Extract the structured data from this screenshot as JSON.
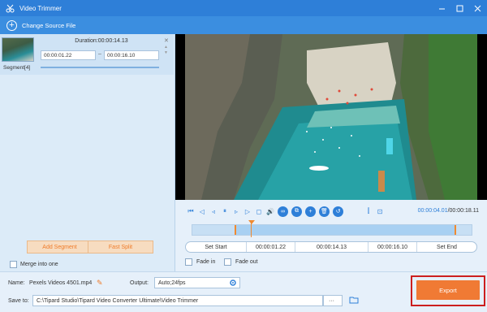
{
  "window": {
    "title": "Video Trimmer"
  },
  "source": {
    "change_label": "Change Source File"
  },
  "segment": {
    "label": "Segment[4]",
    "duration_label": "Duration:00:00:14.13",
    "start": "00:00:01.22",
    "end": "00:00:16.10",
    "dash": "–"
  },
  "left_actions": {
    "add_segment": "Add Segment",
    "fast_split": "Fast Split",
    "merge": "Merge into one"
  },
  "player": {
    "current_time": "00:00:04.01",
    "total_time": "/00:00:18.11"
  },
  "trim": {
    "set_start": "Set Start",
    "start_time": "00:00:01.22",
    "duration": "00:00:14.13",
    "end_time": "00:00:16.10",
    "set_end": "Set End",
    "fade_in": "Fade in",
    "fade_out": "Fade out"
  },
  "output": {
    "name_label": "Name:",
    "name_value": "Pexels Videos 4501.mp4",
    "output_label": "Output:",
    "output_value": "Auto;24fps",
    "save_label": "Save to:",
    "save_path": "C:\\Tipard Studio\\Tipard Video Converter Ultimate\\Video Trimmer",
    "more": "···",
    "export_label": "Export"
  },
  "colors": {
    "accent": "#2e7fd8",
    "export": "#f07a34",
    "highlight": "#cc1f1f"
  }
}
